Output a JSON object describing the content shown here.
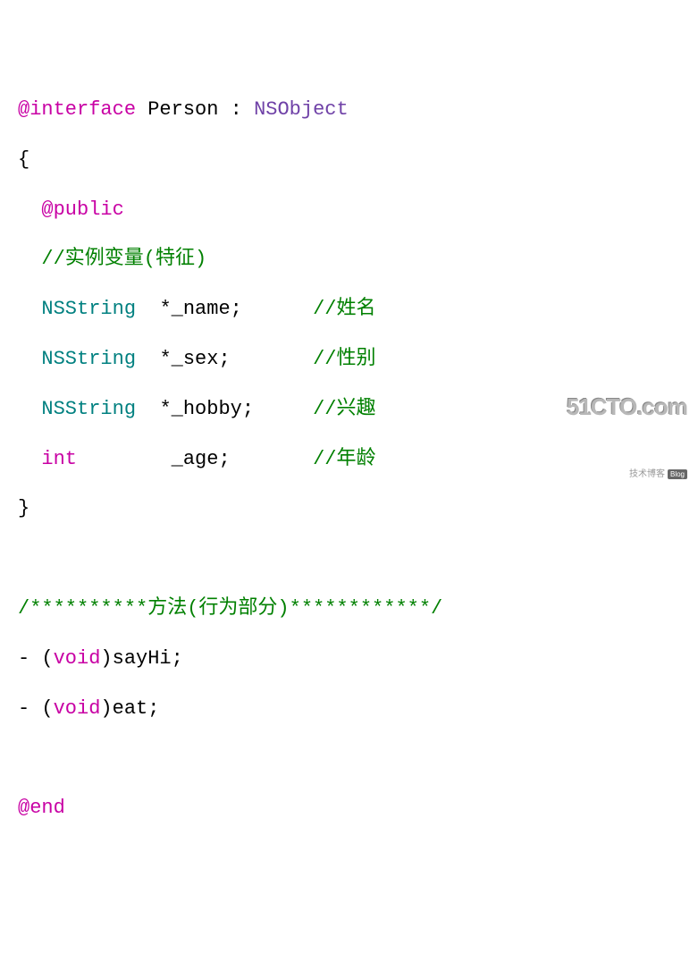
{
  "tokens": {
    "interface": "@interface",
    "className": "Person",
    "colon": ":",
    "superclass": "NSObject",
    "openBrace": "{",
    "public": "@public",
    "commentVars": "//实例变量(特征)",
    "nsstring1": "NSString",
    "var1": "*_name;",
    "commentName": "//姓名",
    "nsstring2": "NSString",
    "var2": "*_sex;",
    "commentSex": "//性别",
    "nsstring3": "NSString",
    "var3": "*_hobby;",
    "commentHobby": "//兴趣",
    "intType": "int",
    "var4": "_age;",
    "commentAge": "//年龄",
    "closeBrace": "}",
    "methodsComment": "/**********方法(行为部分)************/",
    "dash1": "- (",
    "void1": "void",
    "sayHi": ")sayHi;",
    "dash2": "- (",
    "void2": "void",
    "eat": ")eat;",
    "end": "@end"
  },
  "watermark": {
    "main": "51CTO.com",
    "sub": "技术博客",
    "blog": "Blog"
  }
}
